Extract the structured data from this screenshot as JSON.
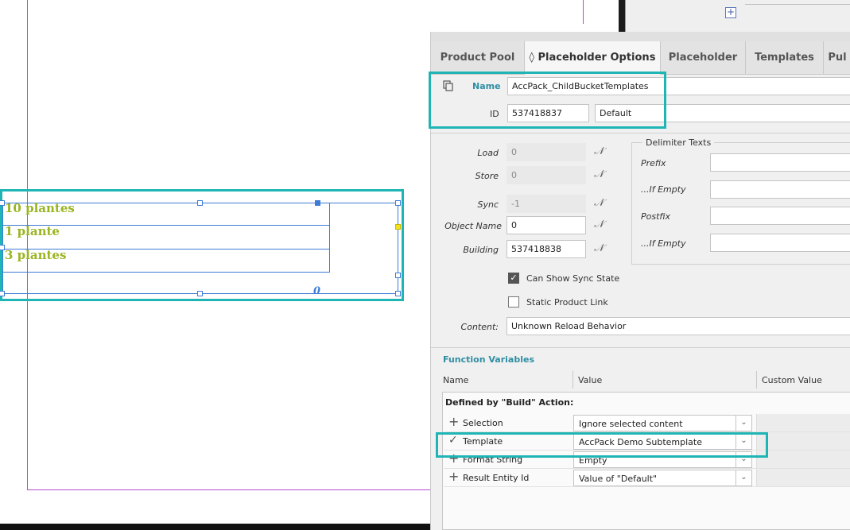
{
  "canvas": {
    "text_lines": [
      "10 plantes",
      "1 plante",
      "3 plantes"
    ],
    "overflow_marker": "0"
  },
  "tabs": [
    {
      "label": "Product Pool"
    },
    {
      "label": "◊ Placeholder Options"
    },
    {
      "label": "Placeholder"
    },
    {
      "label": "Templates"
    },
    {
      "label": "Pul"
    }
  ],
  "header": {
    "name_label": "Name",
    "name_value": "AccPack_ChildBucketTemplates",
    "id_label": "ID",
    "id_value": "537418837",
    "id_default": "Default"
  },
  "props": {
    "load_label": "Load",
    "load_value": "0",
    "store_label": "Store",
    "store_value": "0",
    "sync_label": "Sync",
    "sync_value": "-1",
    "object_name_label": "Object Name",
    "object_name_value": "0",
    "building_label": "Building",
    "building_value": "537418838",
    "can_show_sync_label": "Can Show Sync State",
    "can_show_sync_checked": true,
    "static_link_label": "Static Product Link",
    "static_link_checked": false,
    "content_label": "Content:",
    "content_value": "Unknown Reload Behavior"
  },
  "delimiters": {
    "title": "Delimiter Texts",
    "prefix_label": "Prefix",
    "if_empty_1_label": "...If Empty",
    "postfix_label": "Postfix",
    "if_empty_2_label": "...If Empty"
  },
  "function_variables": {
    "title": "Function Variables",
    "col_name": "Name",
    "col_value": "Value",
    "col_custom": "Custom Value",
    "group_label": "Defined by \"Build\" Action:",
    "rows": [
      {
        "marker": "+",
        "name": "Selection",
        "value": "Ignore selected content"
      },
      {
        "marker": "✓",
        "name": "Template",
        "value": "AccPack Demo Subtemplate"
      },
      {
        "marker": "+",
        "name": "Format String",
        "value": "Empty"
      },
      {
        "marker": "+",
        "name": "Result Entity Id",
        "value": "Value of \"Default\""
      }
    ]
  },
  "colors": {
    "highlight": "#1fb5b5",
    "accent_title": "#2f8ea3",
    "frame_text": "#9ab520",
    "frame_lines": "#3d7bd6",
    "guides": "#b54cd6"
  }
}
